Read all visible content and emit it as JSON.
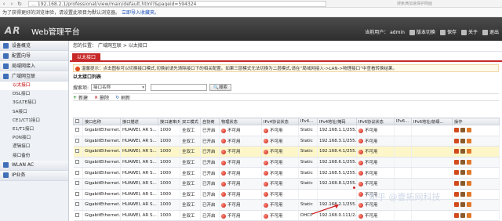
{
  "browser": {
    "url": "… 192.168.2.1/professional/view/main/default.html?&pageid=594324",
    "search_hint": "搜索满加速保护网面",
    "favbar_text": "为了获得更好的浏览体验，请设置此项目为默认浏览器。",
    "favbar_link": "立即导入收藏夹。"
  },
  "header": {
    "logo": "AR",
    "title": "Web管理平台",
    "user_label": "当前用户： admin",
    "version_switch": "版本切换",
    "save": "保存",
    "about": "关于",
    "logout": "退出"
  },
  "sidebar": {
    "items": [
      {
        "label": "设备概览"
      },
      {
        "label": "配置向导"
      },
      {
        "label": "局域网接入"
      },
      {
        "label": "广域网互联"
      }
    ],
    "subitems": [
      {
        "label": "以太接口",
        "active": true
      },
      {
        "label": "DSL接口"
      },
      {
        "label": "3G/LTE接口"
      },
      {
        "label": "SA接口"
      },
      {
        "label": "CE1/CT1接口"
      },
      {
        "label": "E1/T1接口"
      },
      {
        "label": "PON接口"
      },
      {
        "label": "逻辑接口"
      },
      {
        "label": "接口备份"
      }
    ],
    "bottom_items": [
      {
        "label": "WLAN AC"
      },
      {
        "label": "IP业务"
      }
    ]
  },
  "main": {
    "breadcrumb": "您的位置： 广域网互联 > 以太接口",
    "tab": "以太接口",
    "tip": "温馨提示：点击图标可以切换接口模式,切换前请先清除接口下的相关配置。如果三层模式无法切换为二层模式,请在“局域网接入->LAN->物理接口”中查看转换结果。",
    "list_title": "以太接口列表",
    "search_label": "搜索项:",
    "search_select": "接口名称",
    "search_button": "搜索",
    "toolbar": {
      "new": "新建",
      "delete": "删除",
      "refresh": "刷新"
    }
  },
  "table": {
    "columns": [
      "",
      "接口名称",
      "接口描述",
      "接口速率(M)",
      "双工模式",
      "自协商",
      "物理状态",
      "IPv4协议状态",
      "IPv4...",
      "IPv4地址/掩码",
      "IPv6协议状态",
      "IPv6...",
      "IPv6地址/前缀...",
      "操作"
    ],
    "rows": [
      [
        "GigabitEthernet...",
        "HUAWEI, AR S...",
        "1000",
        "全双工",
        "已开启",
        "不可用",
        "不可用",
        "Static",
        "192.168.1.1/255....",
        "不可用",
        "",
        ""
      ],
      [
        "GigabitEthernet...",
        "HUAWEI, AR S...",
        "1000",
        "全双工",
        "已开启",
        "不可用",
        "不可用",
        "Static",
        "192.168.3.1/255....",
        "不可用",
        "",
        ""
      ],
      [
        "GigabitEthernet...",
        "HUAWEI, AR S...",
        "1000",
        "全双工",
        "已开启",
        "不可用",
        "不可用",
        "Static",
        "192.168.4.1/255....",
        "不可用",
        "",
        ""
      ],
      [
        "GigabitEthernet...",
        "HUAWEI, AR S...",
        "1000",
        "全双工",
        "已开启",
        "不可用",
        "不可用",
        "Static",
        "192.168.6.1/255....",
        "不可用",
        "",
        ""
      ],
      [
        "GigabitEthernet...",
        "HUAWEI, AR S...",
        "1000",
        "全双工",
        "已开启",
        "不可用",
        "不可用",
        "Static",
        "192.168.5.1/255....",
        "不可用",
        "",
        ""
      ],
      [
        "GigabitEthernet...",
        "HUAWEI, AR S...",
        "1000",
        "全双工",
        "已开启",
        "不可用",
        "不可用",
        "Static",
        "192.168.8.1/255....",
        "不可用",
        "",
        ""
      ],
      [
        "GigabitEthernet...",
        "HUAWEI, AR S...",
        "1000",
        "全双工",
        "已开启",
        "不可用",
        "不可用",
        "",
        "",
        "不可用",
        "",
        ""
      ],
      [
        "GigabitEthernet...",
        "HUAWEI, AR S...",
        "1000",
        "全双工",
        "已开启",
        "不可用",
        "不可用",
        "Static",
        "192.168.2.1/255....",
        "不可用",
        "",
        ""
      ],
      [
        "GigabitEthernet...",
        "HUAWEI, AR S...",
        "1000",
        "全双工",
        "已开启",
        "不可用",
        "不可用",
        "DHCP",
        "192.168.0.111/2...",
        "不可用",
        "",
        ""
      ],
      [
        "GigabitEthernet...",
        "HUAWEI, AR S...",
        "1000",
        "全双工",
        "已开启",
        "不可用",
        "不可用",
        "",
        "",
        "不可用",
        "",
        ""
      ]
    ],
    "dot_status_cols": [
      5,
      6,
      9
    ]
  },
  "watermark": "知乎 @壹拓网科技",
  "colors": {
    "accent_red": "#c82828",
    "header_dark": "#3a3a3a",
    "status_dot": "#c41b12",
    "highlight_row": "#fcf6c9"
  }
}
